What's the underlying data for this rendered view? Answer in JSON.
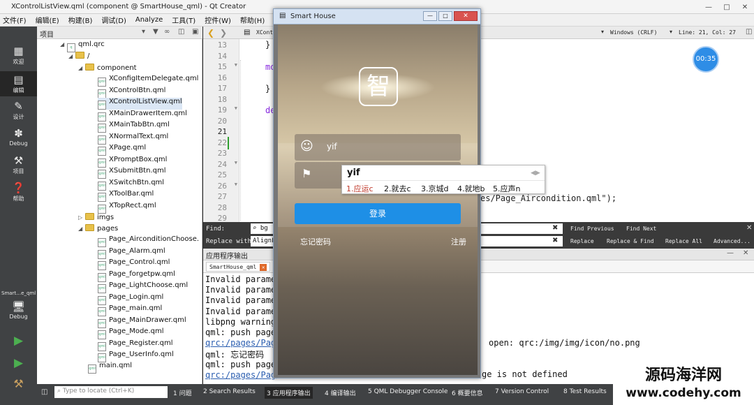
{
  "window_title": "XControlListView.qml (component @ SmartHouse_qml) - Qt Creator",
  "menu": [
    "文件(F)",
    "编辑(E)",
    "构建(B)",
    "调试(D)",
    "Analyze",
    "工具(T)",
    "控件(W)",
    "帮助(H)"
  ],
  "modes": [
    {
      "icon": "grid-icon",
      "label": "欢迎"
    },
    {
      "icon": "edit-icon",
      "label": "编辑"
    },
    {
      "icon": "design-icon",
      "label": "设计"
    },
    {
      "icon": "bug-icon",
      "label": "Debug"
    },
    {
      "icon": "wrench-icon",
      "label": "项目"
    },
    {
      "icon": "help-icon",
      "label": "帮助"
    }
  ],
  "kit": {
    "name": "Smart…e_qml",
    "build": "Debug"
  },
  "project_header": "项目",
  "tree": {
    "root": "qml.qrc",
    "slash": "/",
    "component": "component",
    "files": [
      "XConfigItemDelegate.qml",
      "XControlBtn.qml",
      "XControlListView.qml",
      "XMainDrawerItem.qml",
      "XMainTabBtn.qml",
      "XNormalText.qml",
      "XPage.qml",
      "XPromptBox.qml",
      "XSubmitBtn.qml",
      "XSwitchBtn.qml",
      "XToolBar.qml",
      "XTopRect.qml"
    ],
    "imgs": "imgs",
    "pages": "pages",
    "page_files": [
      "Page_AirconditionChoose.",
      "Page_Alarm.qml",
      "Page_Control.qml",
      "Page_forgetpw.qml",
      "Page_LightChoose.qml",
      "Page_Login.qml",
      "Page_main.qml",
      "Page_MainDrawer.qml",
      "Page_Mode.qml",
      "Page_Register.qml",
      "Page_UserInfo.qml"
    ],
    "main": "main.qml"
  },
  "editor_tab": "XCont",
  "editor_status": {
    "encoding": "Windows (CRLF)",
    "position": "Line: 21, Col: 27"
  },
  "line_numbers": [
    "13",
    "14",
    "15",
    "16",
    "17",
    "18",
    "19",
    "20",
    "21",
    "22",
    "23",
    "24",
    "25",
    "26",
    "27",
    "28",
    "29"
  ],
  "code": {
    "l13": "}",
    "l15": "mo",
    "l17": "}",
    "l19": "de",
    "l27": "es/Page_Aircondition.qml\");"
  },
  "timer": "00:35",
  "find": {
    "find_label": "Find:",
    "replace_label": "Replace with:",
    "find_value": "bg",
    "replace_value": "AlignL",
    "find_previous": "Find Previous",
    "find_next": "Find Next",
    "replace": "Replace",
    "replace_find": "Replace & Find",
    "replace_all": "Replace All",
    "advanced": "Advanced..."
  },
  "output": {
    "header": "应用程序输出",
    "tab": "SmartHouse_qml",
    "lines": [
      "Invalid parame",
      "Invalid parame",
      "Invalid parame",
      "Invalid parame",
      "libpng warning",
      "qml: push page",
      "qrc:/pages/Pag",
      "qml: 忘记密码",
      "qml: push page",
      "qrc:/pages/Pag"
    ],
    "right1": "open: qrc:/img/img/icon/no.png",
    "right2": "ge is not defined"
  },
  "status": {
    "locate_placeholder": "Type to locate (Ctrl+K)",
    "tabs": [
      "1 问题",
      "2 Search Results",
      "3 应用程序输出",
      "4 编译输出",
      "5 QML Debugger Console",
      "6 概要信息",
      "7 Version Control",
      "8 Test Results"
    ]
  },
  "app": {
    "title": "Smart House",
    "logo": "智",
    "username": "yif",
    "forgot": "忘记密码",
    "register": "注册",
    "login": "登录"
  },
  "ime": {
    "input": "yif",
    "candidates": [
      "1.应运c",
      "2.就去c",
      "3.京城d",
      "4.就地b",
      "5.应声n"
    ]
  },
  "watermark": {
    "cn": "源码海洋网",
    "url": "www.codehy.com"
  },
  "colors": {
    "accent": "#1e8fe6",
    "sidebar": "#404244"
  }
}
